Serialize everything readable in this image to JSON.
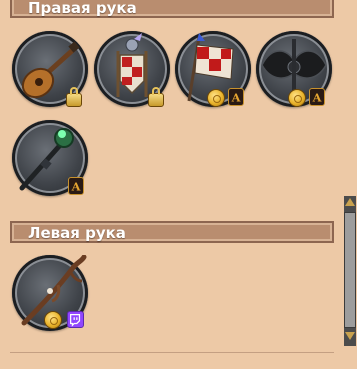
{
  "sections": {
    "right_hand": {
      "title": "Правая рука"
    },
    "left_hand": {
      "title": "Левая рука"
    }
  },
  "icons": {
    "lute": "lute-icon",
    "knight_banner": "knight-banner-icon",
    "flag": "checkered-flag-icon",
    "axe": "black-axe-icon",
    "staff": "green-crystal-staff-icon",
    "branch_staff": "branch-staff-icon",
    "coin": "coin-icon",
    "crest": "crest-a-icon",
    "lock": "lock-icon",
    "twitch": "twitch-icon"
  },
  "crest_letter": "A",
  "colors": {
    "panel_bg": "#edc9a6",
    "header_bg": "#b98d6f",
    "header_text": "#ffffff",
    "twitch": "#9146ff",
    "gold": "#e9b32a"
  }
}
